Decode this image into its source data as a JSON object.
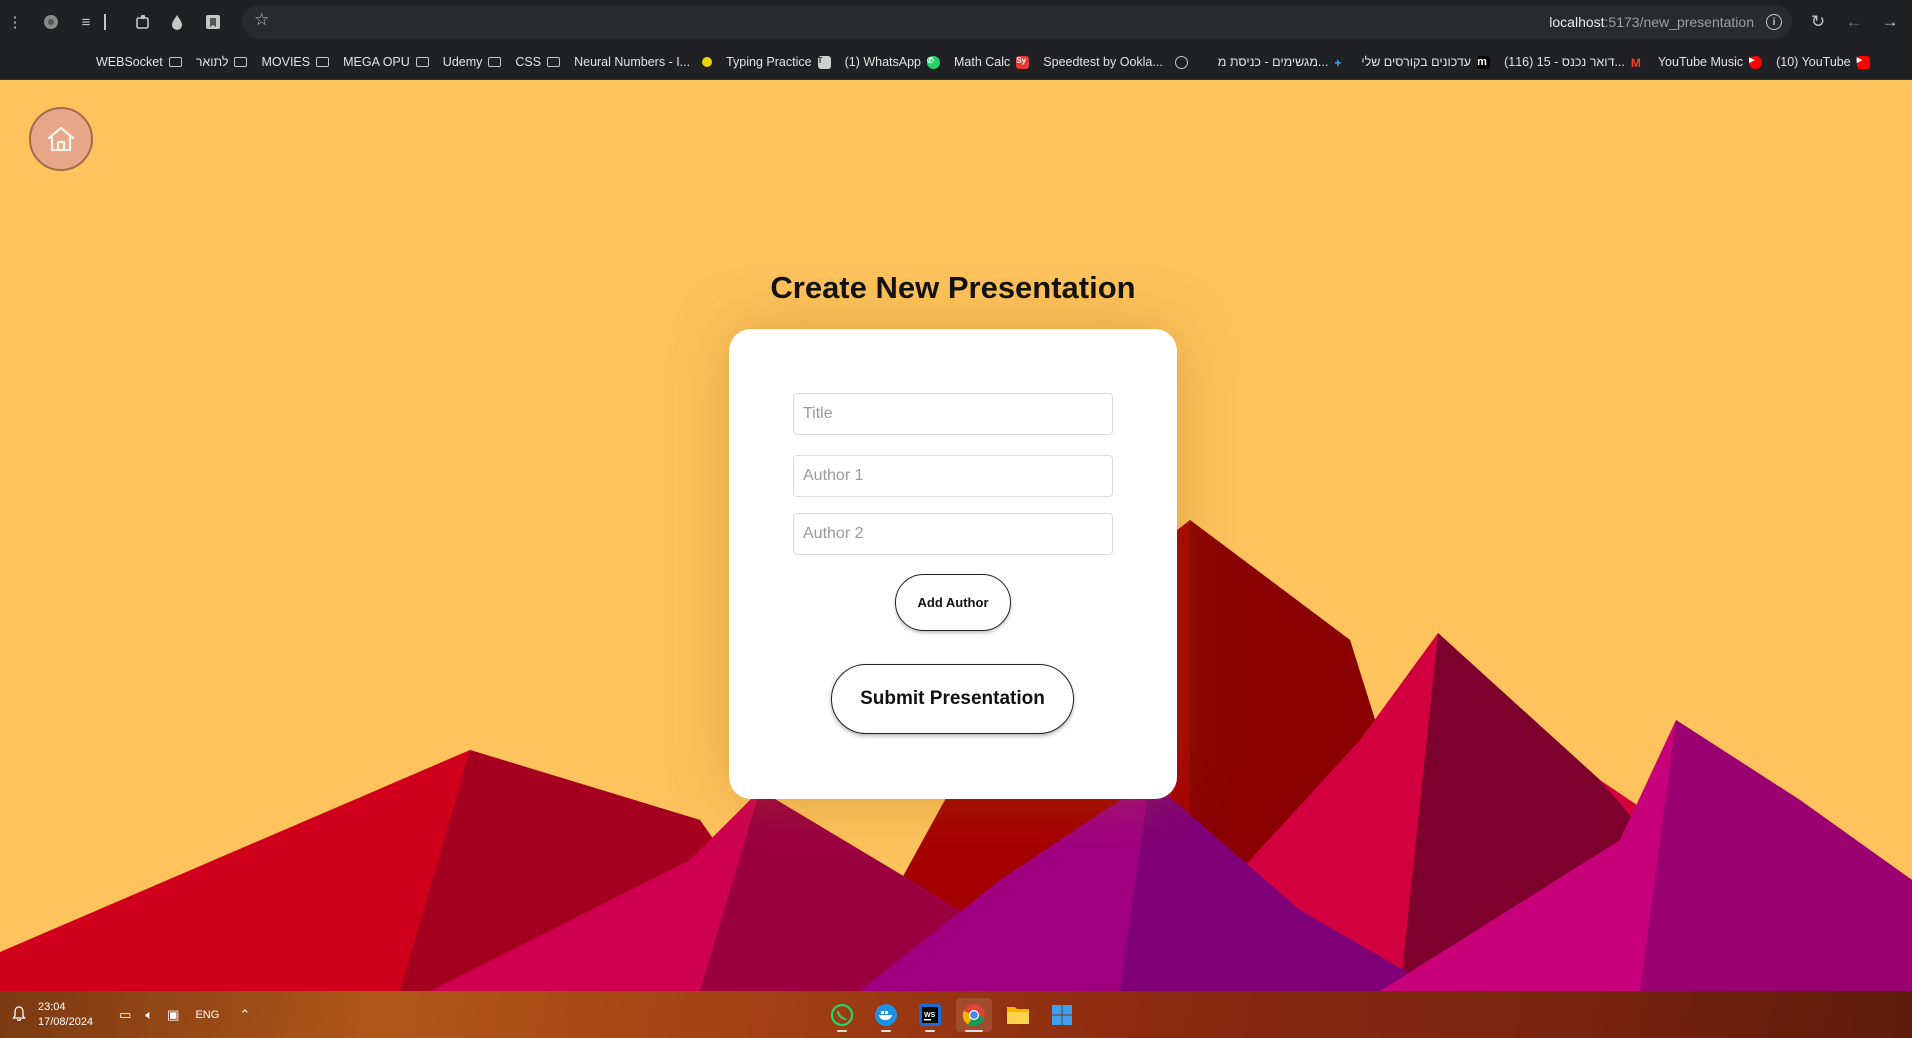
{
  "browser": {
    "url_host": "localhost",
    "url_path": ":5173/new_presentation",
    "bookmarks": [
      {
        "label": "WEBSocket",
        "icon": "folder-icon"
      },
      {
        "label": "לתואר",
        "icon": "folder-icon"
      },
      {
        "label": "MOVIES",
        "icon": "folder-icon"
      },
      {
        "label": "MEGA OPU",
        "icon": "folder-icon"
      },
      {
        "label": "Udemy",
        "icon": "folder-icon"
      },
      {
        "label": "CSS",
        "icon": "folder-icon"
      },
      {
        "label": "Neural Numbers - I...",
        "icon": "yellow-dot-icon"
      },
      {
        "label": "Typing Practice",
        "icon": "typing-icon"
      },
      {
        "label": "(1) WhatsApp",
        "icon": "whatsapp-icon"
      },
      {
        "label": "Math Calc",
        "icon": "sy-icon"
      },
      {
        "label": "Speedtest by Ookla...",
        "icon": "speedtest-icon"
      },
      {
        "label": "מגשימים - כניסת מ...",
        "icon": "plus-icon"
      },
      {
        "label": "עדכונים בקורסים שלי",
        "icon": "m-icon"
      },
      {
        "label": "(116) דואר נכנס - 15...",
        "icon": "gmail-icon"
      },
      {
        "label": "YouTube Music",
        "icon": "youtube-music-icon"
      },
      {
        "label": "(10) YouTube",
        "icon": "youtube-icon"
      }
    ]
  },
  "page": {
    "title": "Create New Presentation",
    "form": {
      "title_placeholder": "Title",
      "author1_placeholder": "Author 1",
      "author2_placeholder": "Author 2",
      "title_value": "",
      "author1_value": "",
      "author2_value": "",
      "add_author_label": "Add Author",
      "submit_label": "Submit Presentation"
    }
  },
  "taskbar": {
    "time": "23:04",
    "date": "17/08/2024",
    "language": "ENG",
    "apps": [
      "whatsapp",
      "docker",
      "webstorm",
      "chrome",
      "file-explorer",
      "start"
    ]
  },
  "colors": {
    "background": "#fec35c",
    "home_button": "#e8a788",
    "card": "#ffffff"
  }
}
